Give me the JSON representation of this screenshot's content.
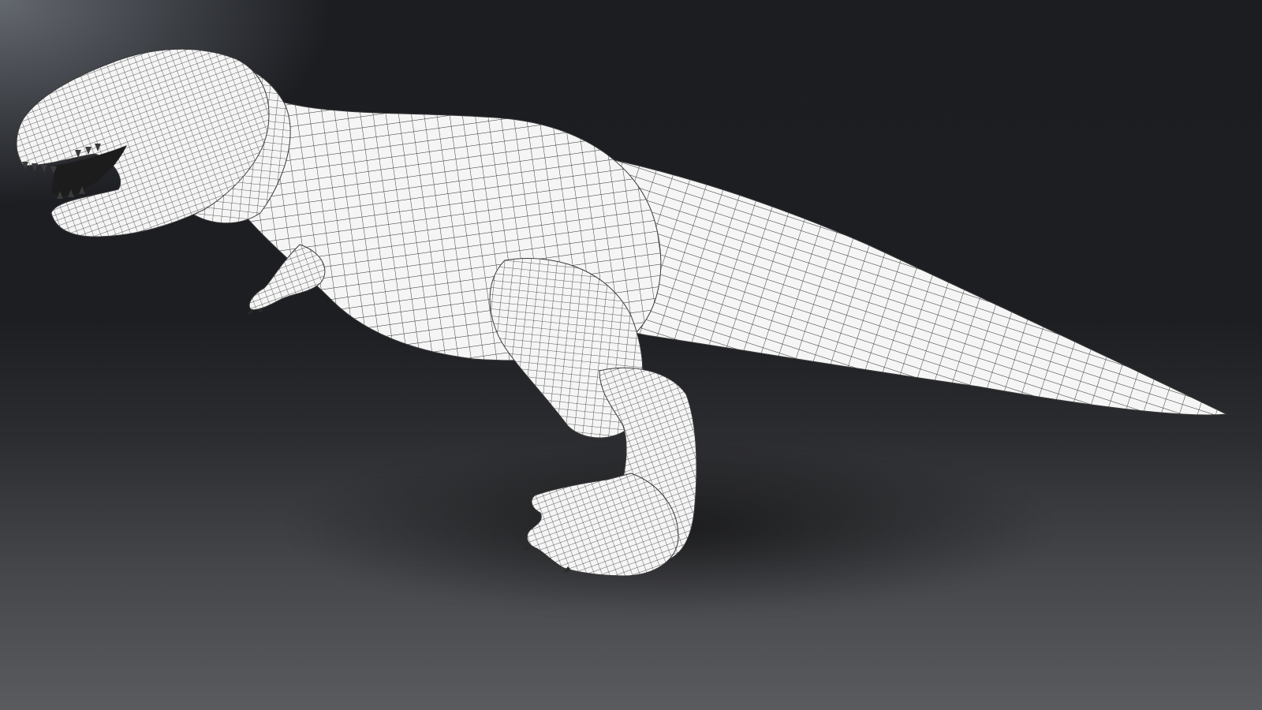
{
  "scene": {
    "subject": "t-rex-wireframe-model",
    "colors": {
      "background_top": "#1b1d21",
      "background_bottom": "#5a5b5e",
      "mesh_fill": "#f4f4f4",
      "mesh_lines": "#2a2a2a",
      "teeth": "#3a3a3a"
    }
  }
}
